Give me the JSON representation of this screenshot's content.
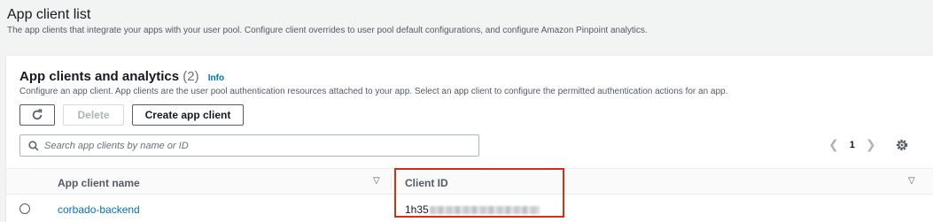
{
  "page": {
    "title": "App client list",
    "description": "The app clients that integrate your apps with your user pool. Configure client overrides to user pool default configurations, and configure Amazon Pinpoint analytics."
  },
  "panel": {
    "title": "App clients and analytics",
    "count": "(2)",
    "info_label": "Info",
    "description": "Configure an app client. App clients are the user pool authentication resources attached to your app. Select an app client to configure the permitted authentication actions for an app."
  },
  "toolbar": {
    "refresh_icon": "refresh-icon",
    "delete_label": "Delete",
    "create_label": "Create app client"
  },
  "search": {
    "placeholder": "Search app clients by name or ID",
    "value": ""
  },
  "pagination": {
    "current_page": "1"
  },
  "table": {
    "columns": [
      "App client name",
      "Client ID"
    ],
    "rows": [
      {
        "name": "corbado-backend",
        "client_id_visible": "1h35"
      }
    ]
  },
  "colors": {
    "accent": "#0073bb",
    "highlight": "#d13212"
  }
}
